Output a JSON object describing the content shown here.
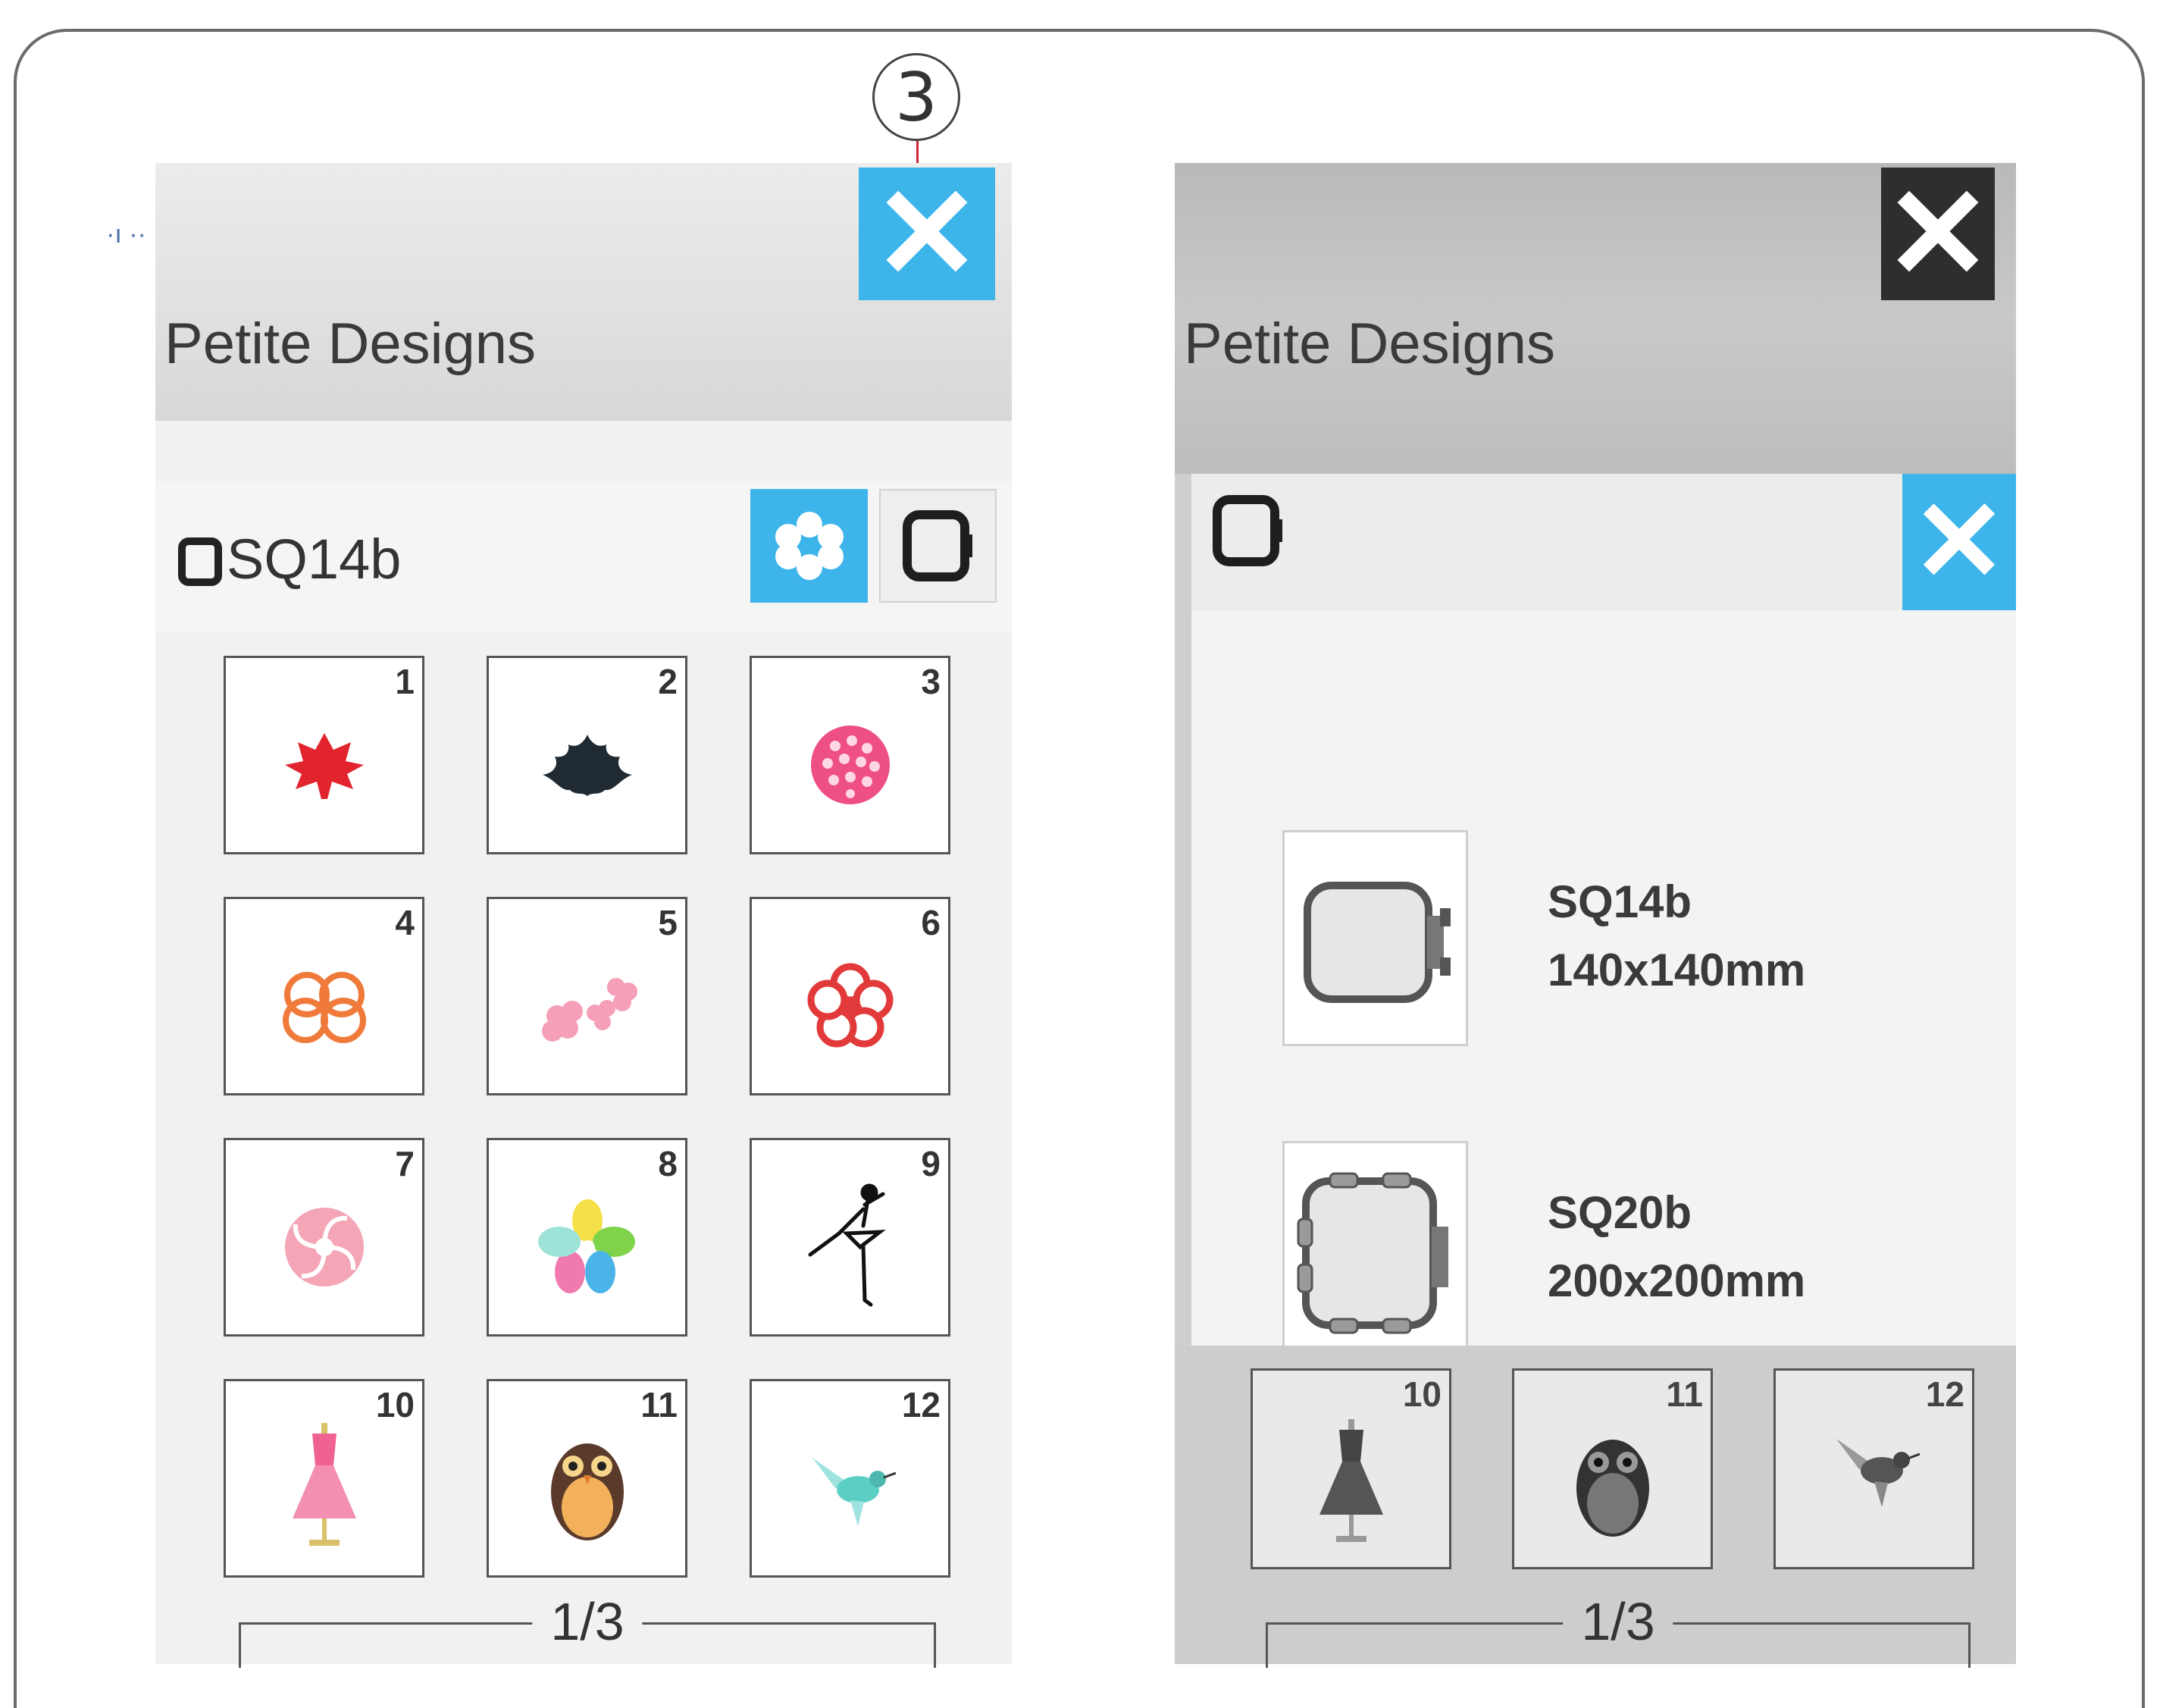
{
  "callout": {
    "number": "3"
  },
  "left_screen": {
    "title": "Petite Designs",
    "close_symbol": "✕",
    "hoop_label": "SQ14b",
    "designs": [
      {
        "num": "1",
        "icon": "maple-leaf-icon"
      },
      {
        "num": "2",
        "icon": "ornament-icon"
      },
      {
        "num": "3",
        "icon": "pink-ball-icon"
      },
      {
        "num": "4",
        "icon": "hibiscus-outline-icon"
      },
      {
        "num": "5",
        "icon": "cherry-blossoms-icon"
      },
      {
        "num": "6",
        "icon": "red-flower-outline-icon"
      },
      {
        "num": "7",
        "icon": "pink-swirl-flower-icon"
      },
      {
        "num": "8",
        "icon": "pinwheel-flower-icon"
      },
      {
        "num": "9",
        "icon": "ballerina-icon"
      },
      {
        "num": "10",
        "icon": "dress-form-icon"
      },
      {
        "num": "11",
        "icon": "owl-icon"
      },
      {
        "num": "12",
        "icon": "hummingbird-icon"
      }
    ],
    "page": "1/3"
  },
  "right_screen": {
    "title": "Petite Designs",
    "close_symbol": "✕",
    "hoops": [
      {
        "name": "SQ14b",
        "size": "140x140mm"
      },
      {
        "name": "SQ20b",
        "size": "200x200mm"
      }
    ],
    "dimmed_designs": [
      {
        "num": "10",
        "icon": "dress-form-icon"
      },
      {
        "num": "11",
        "icon": "owl-icon"
      },
      {
        "num": "12",
        "icon": "hummingbird-icon"
      }
    ],
    "page": "1/3"
  },
  "colors": {
    "accent_blue": "#3db5ea",
    "dark_button": "#2e2e2e",
    "leader_red": "#d2233a"
  }
}
